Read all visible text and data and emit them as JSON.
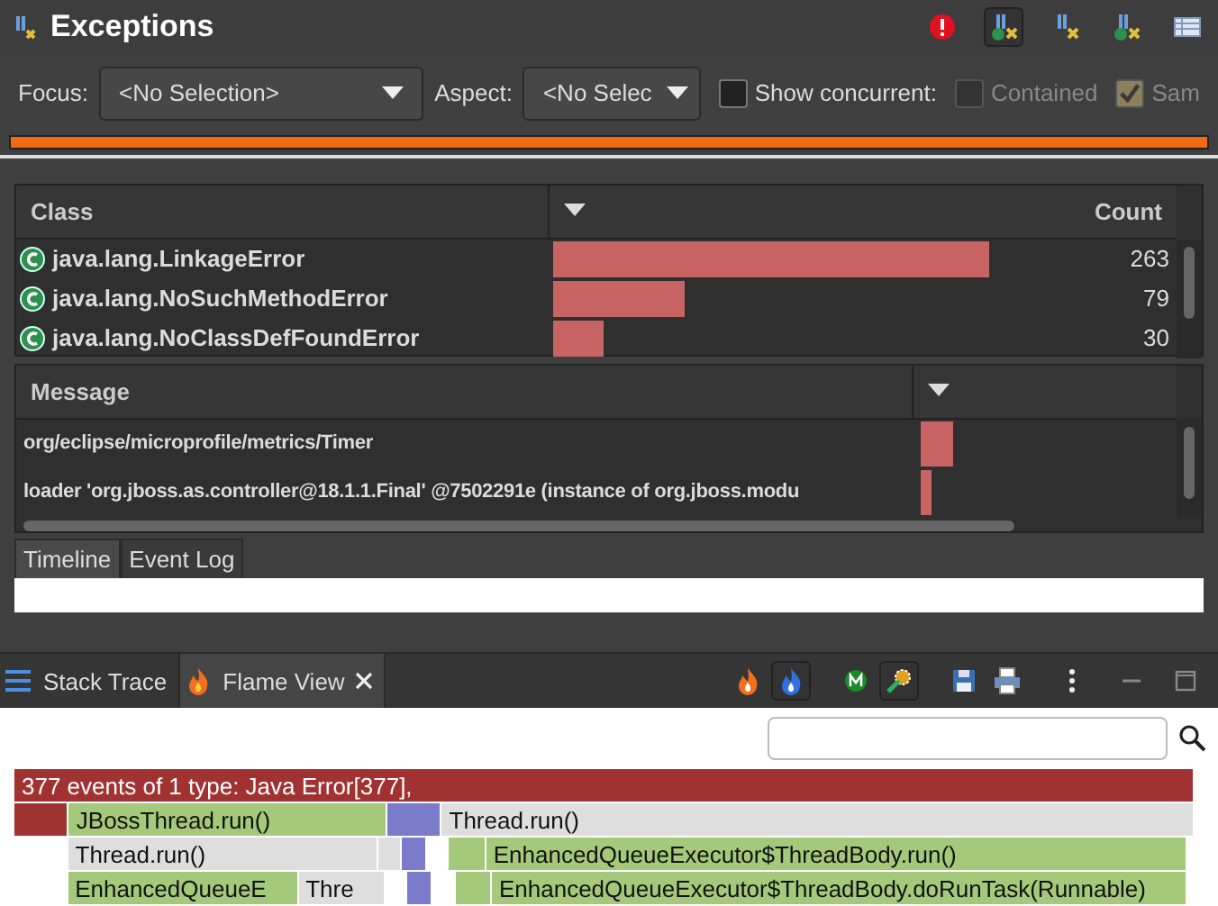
{
  "view": {
    "title": "Exceptions",
    "toolbar": [
      {
        "kind": "error",
        "selected": false
      },
      {
        "kind": "class",
        "selected": true
      },
      {
        "kind": "method",
        "selected": false
      },
      {
        "kind": "classmethod",
        "selected": false
      },
      {
        "kind": "table",
        "selected": false
      }
    ]
  },
  "filters": {
    "focus_label": "Focus:",
    "focus_value": "<No Selection>",
    "aspect_label": "Aspect:",
    "aspect_value": "<No Selec",
    "options": [
      {
        "label": "Show concurrent:",
        "checked": false,
        "disabled": false
      },
      {
        "label": "Contained",
        "checked": false,
        "disabled": true
      },
      {
        "label": "Sam",
        "checked": true,
        "disabled": true
      }
    ]
  },
  "class_table": {
    "columns": [
      "Class",
      "Count"
    ],
    "rows": [
      {
        "name": "java.lang.LinkageError",
        "count": "263"
      },
      {
        "name": "java.lang.NoSuchMethodError",
        "count": "79"
      },
      {
        "name": "java.lang.NoClassDefFoundError",
        "count": "30"
      }
    ]
  },
  "message_table": {
    "columns": [
      "Message"
    ],
    "rows": [
      {
        "text": "org/eclipse/microprofile/metrics/Timer"
      },
      {
        "text": "loader 'org.jboss.as.controller@18.1.1.Final' @7502291e (instance of org.jboss.modu"
      }
    ]
  },
  "tabs": [
    {
      "label": "Timeline",
      "selected": true
    },
    {
      "label": "Event Log",
      "selected": false
    }
  ],
  "bottom_tabs": [
    {
      "label": "Stack Trace",
      "kind": "list",
      "selected": false,
      "closable": false
    },
    {
      "label": "Flame View",
      "kind": "flame",
      "selected": true,
      "closable": true
    }
  ],
  "bottom_toolbar": [
    {
      "kind": "flame",
      "selected": false
    },
    {
      "kind": "blueflame",
      "selected": true
    },
    {
      "kind": "m",
      "selected": false
    },
    {
      "kind": "gear",
      "selected": true
    },
    {
      "kind": "save",
      "selected": false
    },
    {
      "kind": "print",
      "selected": false
    },
    {
      "kind": "menu",
      "selected": false
    }
  ],
  "flame_rows": [
    [
      {
        "kind": "error",
        "text": "377 events of 1 type: Java Error[377],"
      }
    ],
    [
      {
        "kind": "error"
      },
      {
        "kind": "app",
        "text": "JBossThread.run()"
      },
      {
        "kind": "lock"
      },
      {
        "kind": "thread",
        "text": "Thread.run()"
      }
    ],
    [
      {
        "kind": "blank"
      },
      {
        "kind": "thread",
        "text": "Thread.run()"
      },
      {
        "kind": "thread"
      },
      {
        "kind": "lock"
      },
      {
        "kind": "blank"
      },
      {
        "kind": "app"
      },
      {
        "kind": "app",
        "text": "EnhancedQueueExecutor$ThreadBody.run()"
      }
    ],
    [
      {
        "kind": "blank"
      },
      {
        "kind": "app",
        "text": "EnhancedQueueE"
      },
      {
        "kind": "thread",
        "text": "Thre"
      },
      {
        "kind": "blank"
      },
      {
        "kind": "lock"
      },
      {
        "kind": "blank"
      },
      {
        "kind": "app"
      },
      {
        "kind": "app",
        "text": "EnhancedQueueExecutor$ThreadBody.doRunTask(Runnable)"
      }
    ]
  ]
}
